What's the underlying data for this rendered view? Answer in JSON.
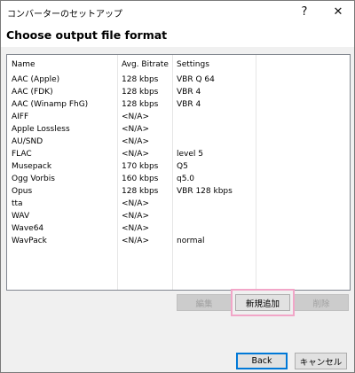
{
  "window": {
    "title": "コンバーターのセットアップ",
    "help_label": "?",
    "close_label": "✕"
  },
  "heading": "Choose output file format",
  "list": {
    "columns": [
      "Name",
      "Avg. Bitrate",
      "Settings"
    ],
    "rows": [
      {
        "name": "AAC (Apple)",
        "bitrate": "128 kbps",
        "settings": "VBR Q 64"
      },
      {
        "name": "AAC (FDK)",
        "bitrate": "128 kbps",
        "settings": "VBR 4"
      },
      {
        "name": "AAC (Winamp FhG)",
        "bitrate": "128 kbps",
        "settings": "VBR 4"
      },
      {
        "name": "AIFF",
        "bitrate": "<N/A>",
        "settings": ""
      },
      {
        "name": "Apple Lossless",
        "bitrate": "<N/A>",
        "settings": ""
      },
      {
        "name": "AU/SND",
        "bitrate": "<N/A>",
        "settings": ""
      },
      {
        "name": "FLAC",
        "bitrate": "<N/A>",
        "settings": "level 5"
      },
      {
        "name": "Musepack",
        "bitrate": "170 kbps",
        "settings": "Q5"
      },
      {
        "name": "Ogg Vorbis",
        "bitrate": "160 kbps",
        "settings": "q5.0"
      },
      {
        "name": "Opus",
        "bitrate": "128 kbps",
        "settings": "VBR 128 kbps"
      },
      {
        "name": "tta",
        "bitrate": "<N/A>",
        "settings": ""
      },
      {
        "name": "WAV",
        "bitrate": "<N/A>",
        "settings": ""
      },
      {
        "name": "Wave64",
        "bitrate": "<N/A>",
        "settings": ""
      },
      {
        "name": "WavPack",
        "bitrate": "<N/A>",
        "settings": "normal"
      }
    ]
  },
  "buttons": {
    "edit": "編集",
    "add_new": "新規追加",
    "delete": "削除",
    "back": "Back",
    "cancel": "キャンセル"
  },
  "colors": {
    "highlight": "#f2a6c8",
    "default_button_border": "#0078d7"
  }
}
